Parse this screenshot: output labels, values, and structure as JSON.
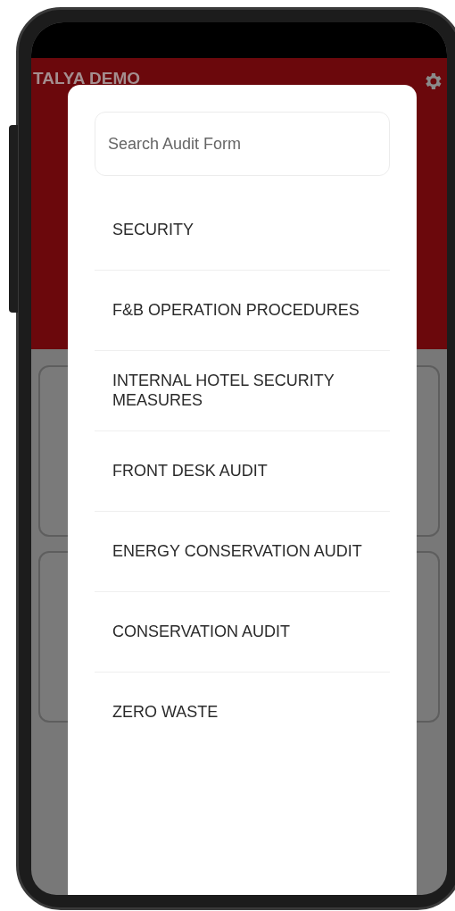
{
  "app_bar": {
    "title": "TALYA DEMO"
  },
  "dialog": {
    "search": {
      "placeholder": "Search Audit Form"
    },
    "items": [
      {
        "label": "SECURITY"
      },
      {
        "label": "F&B OPERATION PROCEDURES"
      },
      {
        "label": "INTERNAL HOTEL SECURITY MEASURES"
      },
      {
        "label": "FRONT DESK AUDIT"
      },
      {
        "label": "ENERGY CONSERVATION AUDIT"
      },
      {
        "label": "CONSERVATION AUDIT"
      },
      {
        "label": "ZERO WASTE"
      }
    ]
  }
}
